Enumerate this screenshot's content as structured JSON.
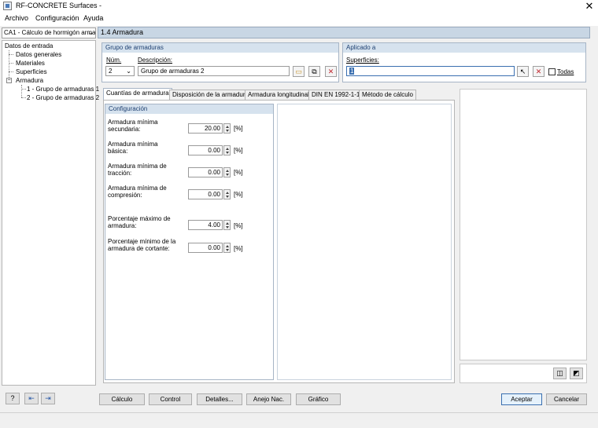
{
  "window": {
    "title": "RF-CONCRETE Surfaces -"
  },
  "menu": {
    "items": [
      "Archivo",
      "Configuración",
      "Ayuda"
    ]
  },
  "case_combo": {
    "value": "CA1 - Cálculo de hormigón arma"
  },
  "section_header": "1.4 Armadura",
  "tree": {
    "root": "Datos de entrada",
    "children": [
      "Datos generales",
      "Materiales",
      "Superficies"
    ],
    "armadura": "Armadura",
    "armadura_children": [
      "1 - Grupo de armaduras 1",
      "2 - Grupo de armaduras 2"
    ]
  },
  "grupo": {
    "header": "Grupo de armaduras",
    "num_label": "Núm.",
    "num_value": "2",
    "desc_label": "Descripción:",
    "desc_value": "Grupo de armaduras 2"
  },
  "aplicado": {
    "header": "Aplicado a",
    "surf_label": "Superficies:",
    "surf_value": "1",
    "todas_label": "Todas"
  },
  "tabs": [
    "Cuantías de armadura",
    "Disposición de la armadura",
    "Armadura longitudinal",
    "DIN EN 1992-1-1",
    "Método de cálculo"
  ],
  "config": {
    "header": "Configuración",
    "rows": [
      {
        "label1": "Armadura mínima",
        "label2": "secundaria:",
        "value": "20.00",
        "unit": "[%]"
      },
      {
        "label1": "Armadura mínima",
        "label2": "básica:",
        "value": "0.00",
        "unit": "[%]"
      },
      {
        "label1": "Armadura mínima de",
        "label2": "tracción:",
        "value": "0.00",
        "unit": "[%]"
      },
      {
        "label1": "Armadura mínima de",
        "label2": "compresión:",
        "value": "0.00",
        "unit": "[%]"
      },
      {
        "label1": "Porcentaje máximo de",
        "label2": "armadura:",
        "value": "4.00",
        "unit": "[%]"
      },
      {
        "label1": "Porcentaje mínimo de la",
        "label2": "armadura de cortante:",
        "value": "0.00",
        "unit": "[%]"
      }
    ]
  },
  "bottom": {
    "calculo": "Cálculo",
    "control": "Control",
    "detalles": "Detalles...",
    "anejo": "Anejo Nac.",
    "grafico": "Gráfico",
    "aceptar": "Aceptar",
    "cancelar": "Cancelar"
  }
}
